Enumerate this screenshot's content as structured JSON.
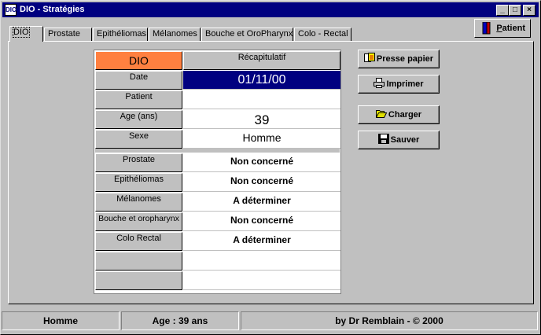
{
  "window": {
    "title": "DIO - Stratégies"
  },
  "titlebar": {
    "minimize": "_",
    "maximize": "□",
    "close": "×"
  },
  "tabs": [
    {
      "label": "DIO",
      "active": true
    },
    {
      "label": "Prostate"
    },
    {
      "label": "Epithéliomas"
    },
    {
      "label": "Mélanomes"
    },
    {
      "label": "Bouche et OroPharynx"
    },
    {
      "label": "Colo - Rectal"
    }
  ],
  "patient_button": {
    "label_u": "P",
    "label_rest": "atient",
    "icon": "patient-icon"
  },
  "grid": {
    "header": {
      "left": "DIO",
      "right": "Récapitulatif",
      "left_color": "#ff8040"
    },
    "rows": [
      {
        "label": "Date",
        "value": "01/11/00"
      },
      {
        "label": "Patient",
        "value": ""
      },
      {
        "label": "Age (ans)",
        "value": "39"
      },
      {
        "label": "Sexe",
        "value": "Homme"
      }
    ],
    "strategies": [
      {
        "label": "Prostate",
        "value": "Non concerné"
      },
      {
        "label": "Epithéliomas",
        "value": "Non concerné"
      },
      {
        "label": "Mélanomes",
        "value": "A déterminer"
      },
      {
        "label": "Bouche et oropharynx",
        "value": "Non concerné"
      },
      {
        "label": "Colo Rectal",
        "value": "A déterminer"
      },
      {
        "label": "",
        "value": ""
      },
      {
        "label": "",
        "value": ""
      }
    ],
    "selection_color": "#000080"
  },
  "buttons": {
    "clipboard": {
      "label": "Presse papier",
      "icon": "clipboard-icon"
    },
    "print": {
      "label": "Imprimer",
      "icon": "printer-icon"
    },
    "load": {
      "label": "Charger",
      "icon": "folder-open-icon"
    },
    "save": {
      "label": "Sauver",
      "icon": "floppy-disk-icon"
    }
  },
  "status": {
    "sex": "Homme",
    "age": "Age : 39 ans",
    "credit": "by Dr Remblain - © 2000"
  }
}
